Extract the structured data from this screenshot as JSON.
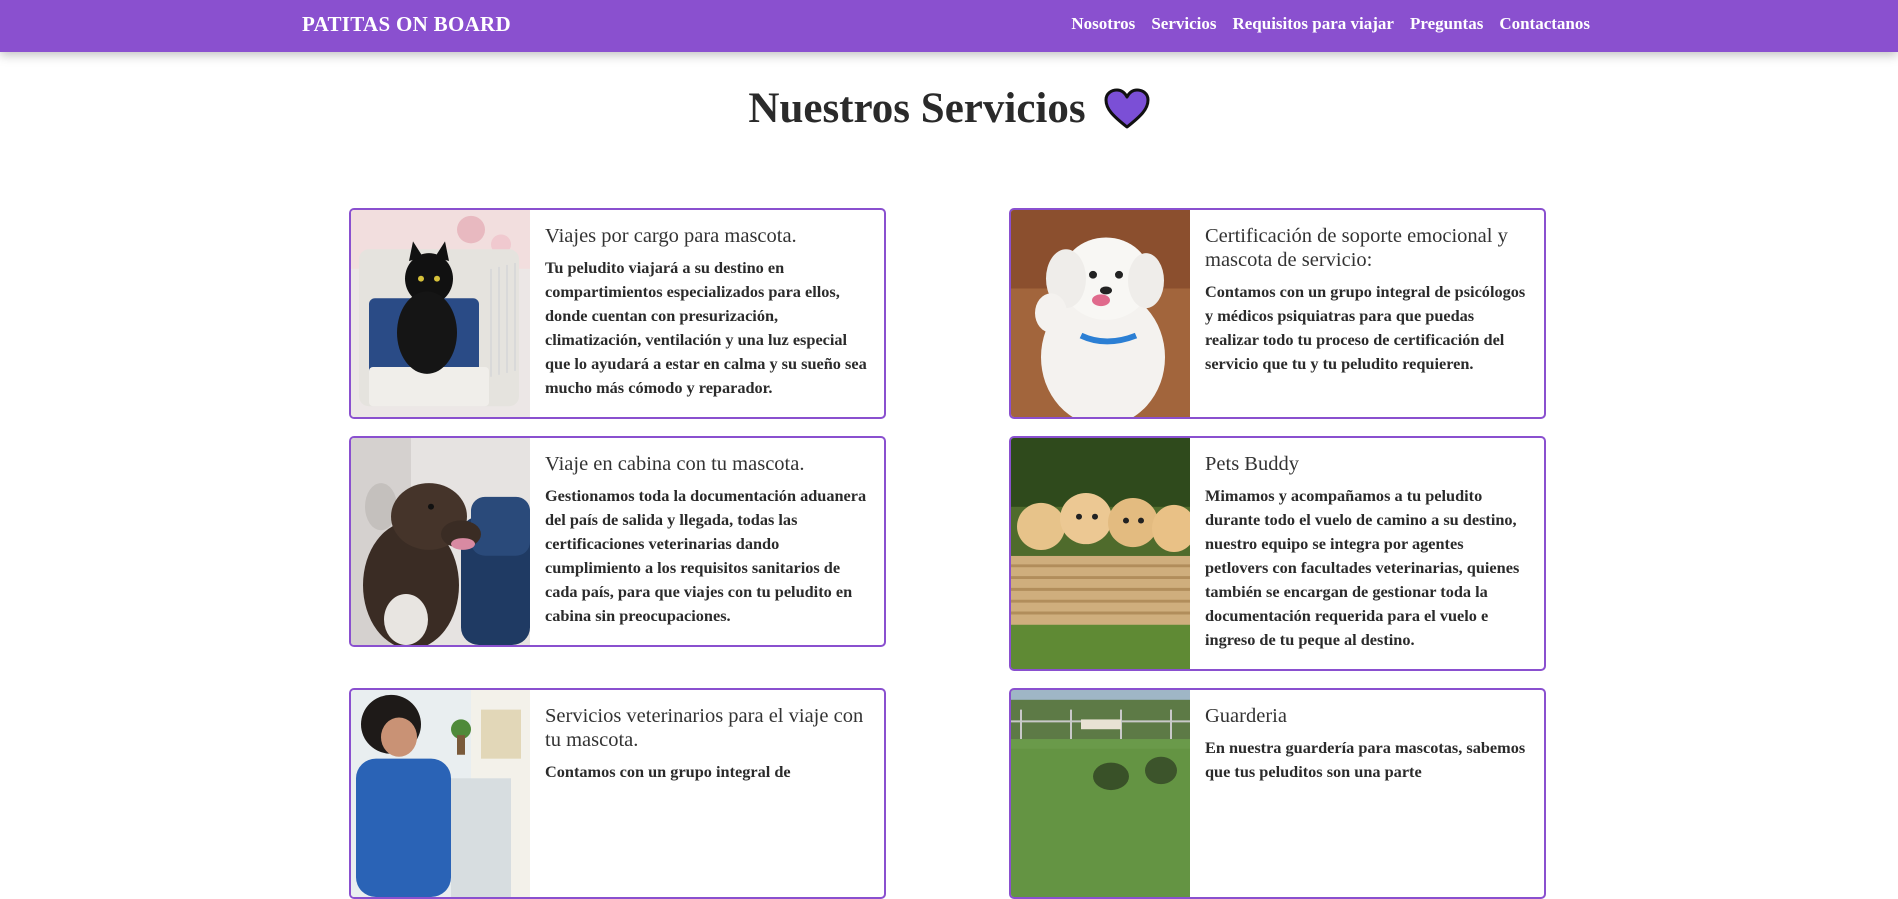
{
  "navbar": {
    "brand": "PATITAS ON BOARD",
    "links": [
      "Nosotros",
      "Servicios",
      "Requisitos para viajar",
      "Preguntas",
      "Contactanos"
    ]
  },
  "page": {
    "title": "Nuestros Servicios",
    "title_icon": "heart-icon",
    "accent_color": "#8a50cf",
    "heart_color": "#7b4fd6"
  },
  "services": [
    {
      "title": "Viajes por cargo para mascota.",
      "description": "Tu peludito viajará a su destino en compartimientos especializados para ellos, donde cuentan con presurización, climatización, ventilación y una luz especial que lo ayudará a estar en calma y su sueño sea mucho más cómodo y reparador.",
      "image": "black cat in pet carrier"
    },
    {
      "title": "Certificación de soporte emocional y mascota de servicio:",
      "description": "Contamos con un grupo integral de psicólogos y médicos psiquiatras para que puedas realizar todo tu proceso de certificación del servicio que tu y tu peludito requieren.",
      "image": "white poodle waving paw"
    },
    {
      "title": "Viaje en cabina con tu mascota.",
      "description": "Gestionamos toda la documentación aduanera del país de salida y llegada, todas las certificaciones veterinarias dando cumplimiento a los requisitos sanitarios de cada país, para que viajes con tu peludito en cabina sin preocupaciones.",
      "image": "dog in airplane cabin"
    },
    {
      "title": "Pets Buddy",
      "description": "Mimamos y acompañamos a tu peludito durante todo el vuelo de camino a su destino, nuestro equipo se integra por agentes petlovers con facultades veterinarias, quienes también se encargan de gestionar toda la documentación requerida para el vuelo e ingreso de tu peque al destino.",
      "image": "puppies in wicker basket"
    },
    {
      "title": "Servicios veterinarios para el viaje con tu mascota.",
      "description": "Contamos con un grupo integral de",
      "image": "veterinarian with pet"
    },
    {
      "title": "Guarderia",
      "description": "En nuestra guardería para mascotas, sabemos que tus peluditos son una parte",
      "image": "dogs playing in park"
    }
  ]
}
